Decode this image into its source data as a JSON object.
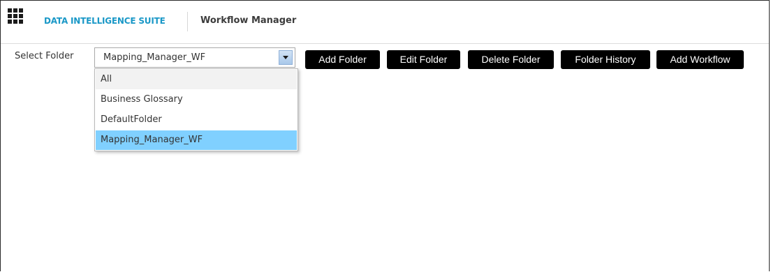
{
  "header": {
    "suite_name": "DATA INTELLIGENCE SUITE",
    "app_name": "Workflow Manager",
    "menu_icon": "grid-menu-icon"
  },
  "toolbar": {
    "select_label": "Select Folder",
    "selected_folder": "Mapping_Manager_WF",
    "buttons": {
      "add_folder": "Add Folder",
      "edit_folder": "Edit Folder",
      "delete_folder": "Delete Folder",
      "folder_history": "Folder History",
      "add_workflow": "Add Workflow"
    }
  },
  "dropdown": {
    "options": [
      "All",
      "Business Glossary",
      "DefaultFolder",
      "Mapping_Manager_WF"
    ],
    "selected_index": 3
  },
  "colors": {
    "brand": "#1a98c7",
    "button_bg": "#000000",
    "selected_option": "#80d0ff"
  }
}
